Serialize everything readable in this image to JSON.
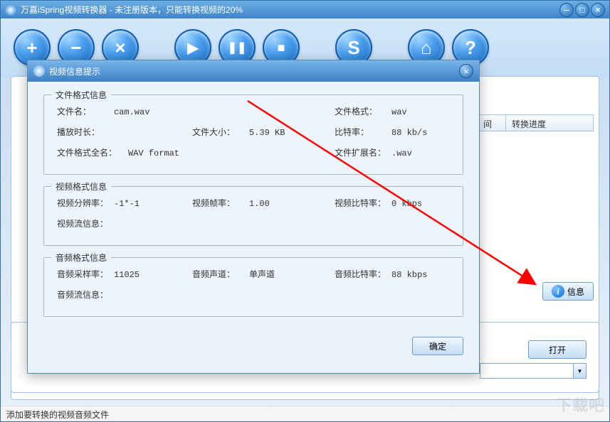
{
  "window": {
    "title": "万嘉iSpring视频转换器 - 未注册版本，只能转换视频的20%"
  },
  "toolbar": {
    "add": "+",
    "remove": "−",
    "clear": "×",
    "play": "▶",
    "pause": "❚❚",
    "stop": "■",
    "settings": "S",
    "home": "⌂",
    "help": "?"
  },
  "table": {
    "col_time": "间",
    "col_progress": "转换进度"
  },
  "side": {
    "info_label": "信息",
    "open_label": "打开"
  },
  "statusbar": {
    "text": "添加要转换的视频音频文件"
  },
  "watermark": "下载吧",
  "dialog": {
    "title": "视频信息提示",
    "ok": "确定",
    "file_section": {
      "legend": "文件格式信息",
      "filename_label": "文件名：",
      "filename_value": "cam.wav",
      "format_label": "文件格式：",
      "format_value": "wav",
      "duration_label": "播放时长：",
      "duration_value": "",
      "filesize_label": "文件大小：",
      "filesize_value": "5.39 KB",
      "bitrate_label": "比特率：",
      "bitrate_value": "88 kb/s",
      "format_full_label": "文件格式全名：",
      "format_full_value": "WAV format",
      "ext_label": "文件扩展名：",
      "ext_value": ".wav"
    },
    "video_section": {
      "legend": "视频格式信息",
      "resolution_label": "视频分辨率：",
      "resolution_value": "-1*-1",
      "fps_label": "视频帧率：",
      "fps_value": "1.00",
      "vbitrate_label": "视频比特率：",
      "vbitrate_value": "0  kbps",
      "stream_label": "视频流信息："
    },
    "audio_section": {
      "legend": "音频格式信息",
      "samplerate_label": "音频采样率：",
      "samplerate_value": "11025",
      "channels_label": "音频声道：",
      "channels_value": "单声道",
      "abitrate_label": "音频比特率：",
      "abitrate_value": "88  kbps",
      "astream_label": "音频流信息："
    }
  }
}
